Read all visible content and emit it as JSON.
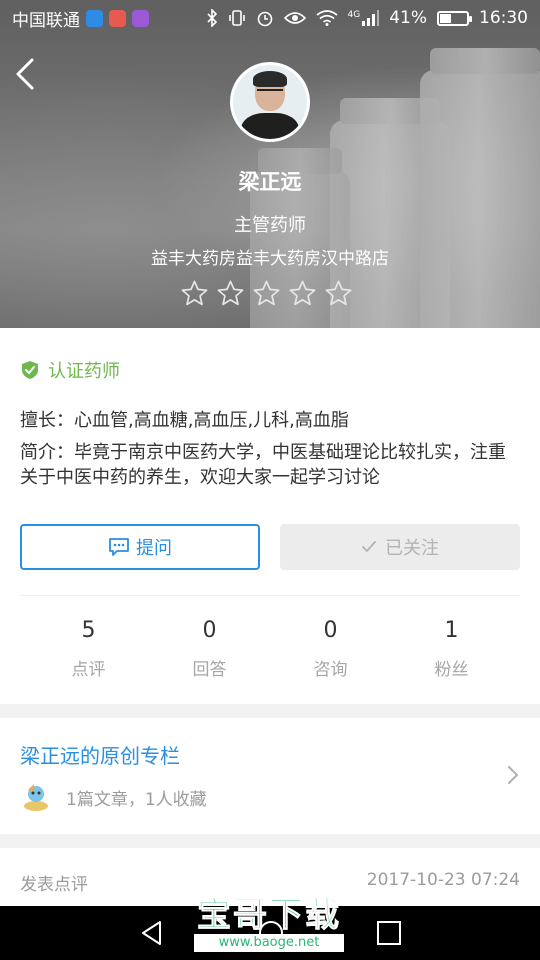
{
  "status_bar": {
    "carrier": "中国联通",
    "network": "4G",
    "battery": "41%",
    "battery_level": 0.41,
    "time": "16:30"
  },
  "profile": {
    "name": "梁正远",
    "title": "主管药师",
    "store": "益丰大药房益丰大药房汉中路店",
    "rating": 0,
    "rating_max": 5
  },
  "certification": {
    "label": "认证药师"
  },
  "specialty": "擅长：心血管,高血糖,高血压,儿科,高血脂",
  "intro": "简介：毕竟于南京中医药大学，中医基础理论比较扎实，注重关于中医中药的养生，欢迎大家一起学习讨论",
  "actions": {
    "ask_label": "提问",
    "follow_label": "已关注"
  },
  "stats": [
    {
      "value": "5",
      "label": "点评"
    },
    {
      "value": "0",
      "label": "回答"
    },
    {
      "value": "0",
      "label": "咨询"
    },
    {
      "value": "1",
      "label": "粉丝"
    }
  ],
  "column": {
    "title": "梁正远的原创专栏",
    "meta": "1篇文章，1人收藏"
  },
  "comments": {
    "label": "发表点评",
    "time": "2017-10-23 07:24"
  },
  "watermark": {
    "big": "宝哥下载",
    "small": "www.baoge.net"
  },
  "colors": {
    "accent_blue": "#2a8fe0",
    "cert_green": "#6fb84f",
    "muted_gray": "#9c9c9c"
  }
}
